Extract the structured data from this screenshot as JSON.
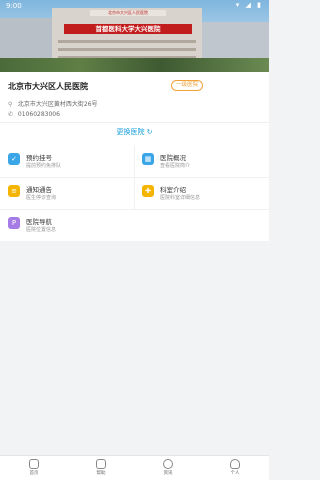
{
  "status_bar": {
    "time": "9:00",
    "system_icons": "▾ ◢ ▮"
  },
  "hero": {
    "sign": "首都医科大学大兴医院",
    "sign_top": "北京市大兴区人民医院"
  },
  "hospital": {
    "name": "北京市大兴区人民医院",
    "badge": "一级医院",
    "address": "北京市大兴区黄村西大街26号",
    "phone": "01060283006",
    "switch_label": "更换医院 ↻"
  },
  "services": [
    {
      "title": "预约挂号",
      "subtitle": "提前预约免排队",
      "icon": "calendar-icon",
      "color": "#3aa6e8"
    },
    {
      "title": "医院概况",
      "subtitle": "查看医院简介",
      "icon": "building-icon",
      "color": "#3aa6e8"
    },
    {
      "title": "通知通告",
      "subtitle": "医生停诊查询",
      "icon": "notice-icon",
      "color": "#f4b400"
    },
    {
      "title": "科室介绍",
      "subtitle": "医院科室详细信息",
      "icon": "shield-icon",
      "color": "#f4b400"
    },
    {
      "title": "医院导航",
      "subtitle": "医院位置信息",
      "icon": "p-letter-icon",
      "color": "#a57be6"
    }
  ],
  "tabbar": [
    {
      "label": "首页",
      "icon": "home-icon"
    },
    {
      "label": "帮助",
      "icon": "help-icon"
    },
    {
      "label": "资讯",
      "icon": "news-icon"
    },
    {
      "label": "个人",
      "icon": "user-icon"
    }
  ]
}
